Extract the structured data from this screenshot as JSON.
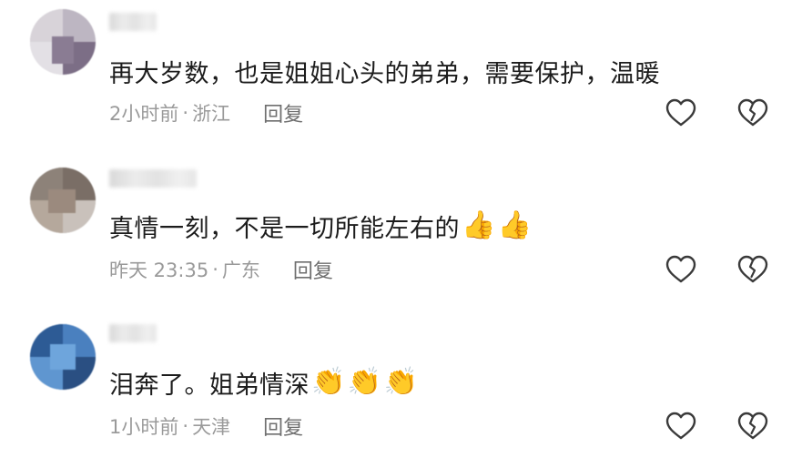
{
  "comments": [
    {
      "text": "再大岁数，也是姐姐心头的弟弟，需要保护，温暖",
      "time": "2小时前",
      "location": "浙江",
      "separator": "·",
      "reply_label": "回复",
      "emojis": []
    },
    {
      "text": "真情一刻，不是一切所能左右的",
      "time": "昨天 23:35",
      "location": "广东",
      "separator": "·",
      "reply_label": "回复",
      "emojis": [
        "👍",
        "👍"
      ]
    },
    {
      "text": "泪奔了。姐弟情深",
      "time": "1小时前",
      "location": "天津",
      "separator": "·",
      "reply_label": "回复",
      "emojis": [
        "👏",
        "👏",
        "👏"
      ]
    }
  ],
  "icons": {
    "like": "heart-outline-icon",
    "dislike": "broken-heart-icon"
  },
  "colors": {
    "text": "#1c1c1c",
    "meta": "#9a9a9a",
    "reply": "#6f6f6f",
    "icon": "#3a3a3a"
  }
}
